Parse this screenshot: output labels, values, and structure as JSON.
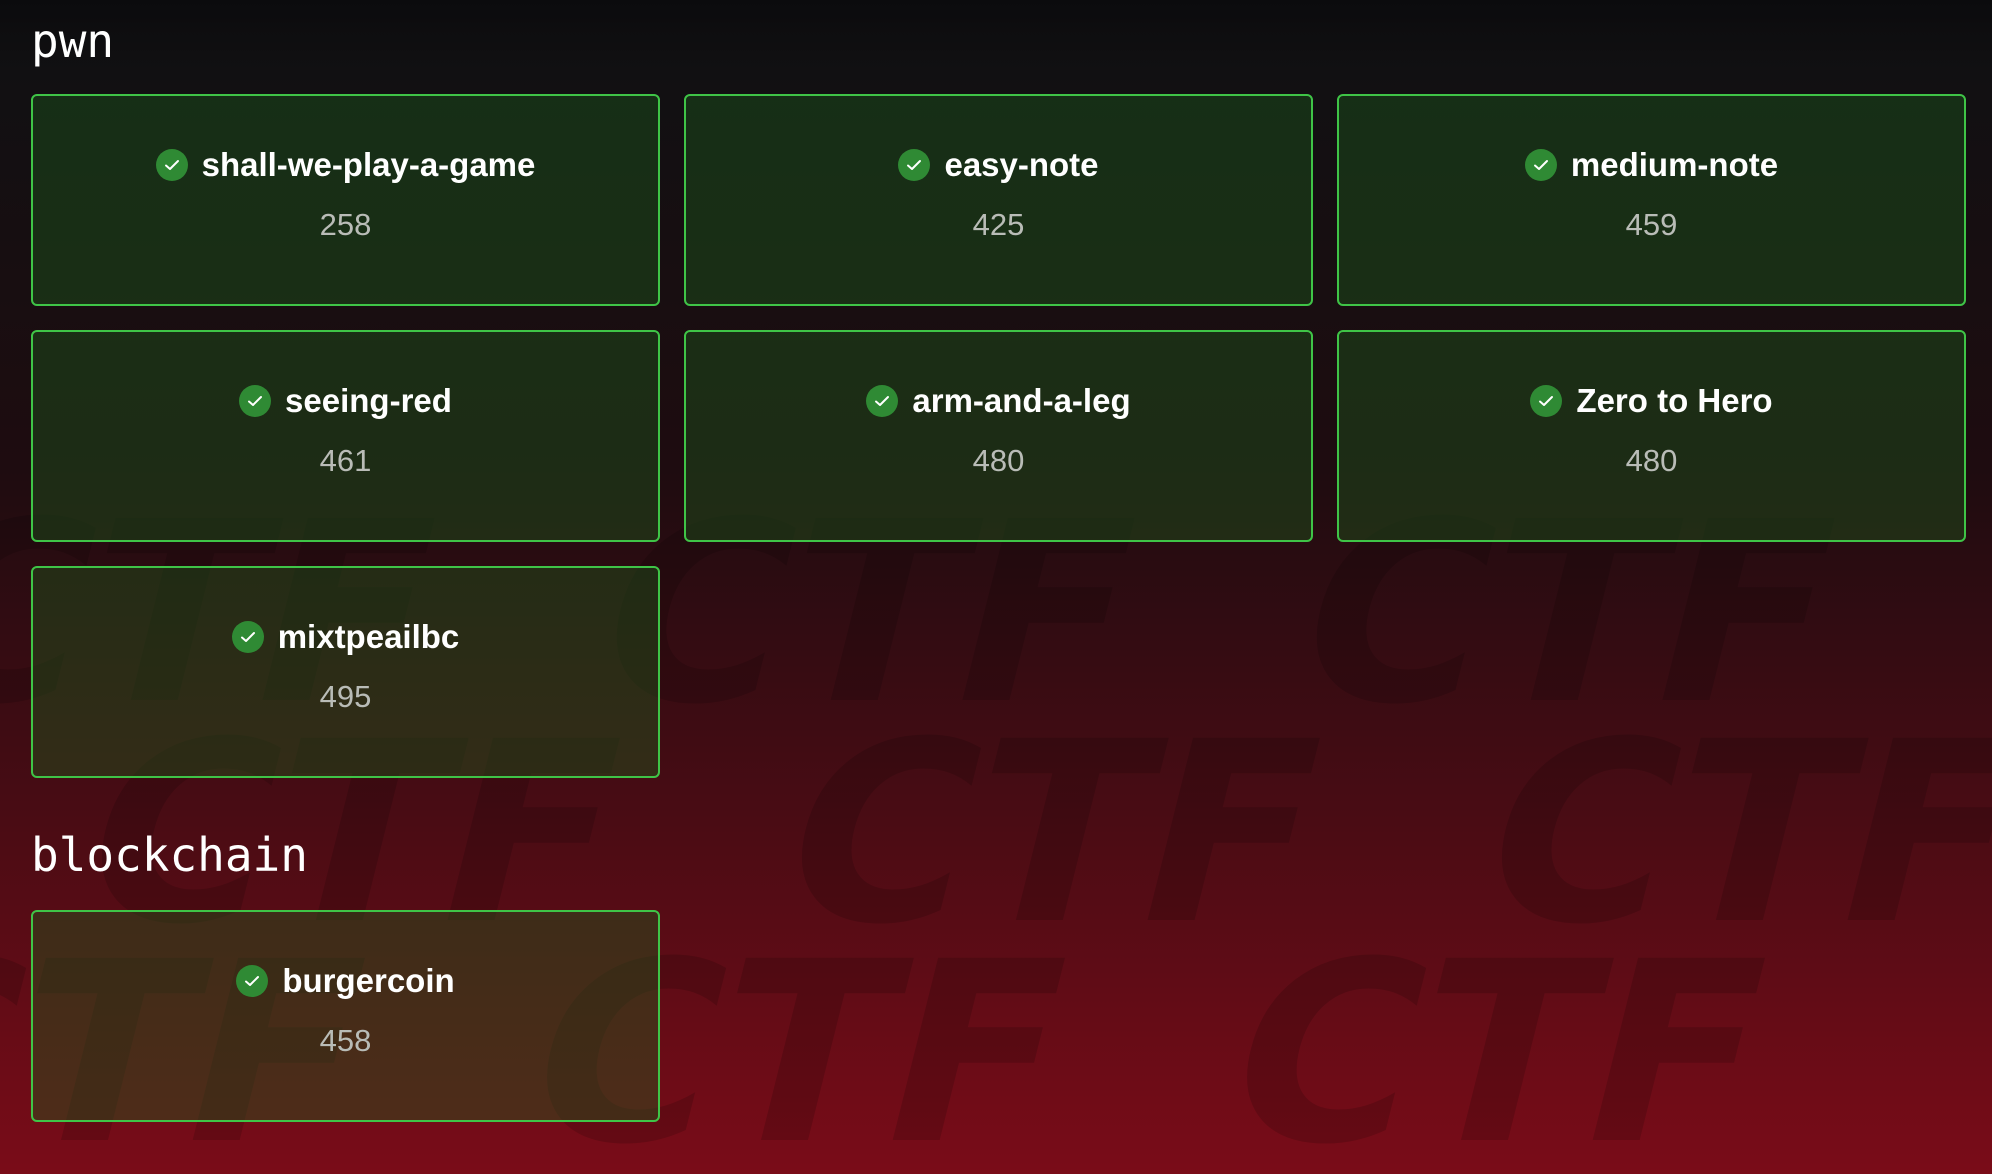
{
  "sections": [
    {
      "title": "pwn",
      "challenges": [
        {
          "name": "shall-we-play-a-game",
          "points": "258",
          "solved_icon": "check-circle-icon"
        },
        {
          "name": "easy-note",
          "points": "425",
          "solved_icon": "check-circle-icon"
        },
        {
          "name": "medium-note",
          "points": "459",
          "solved_icon": "check-circle-icon"
        },
        {
          "name": "seeing-red",
          "points": "461",
          "solved_icon": "check-circle-icon"
        },
        {
          "name": "arm-and-a-leg",
          "points": "480",
          "solved_icon": "check-circle-icon"
        },
        {
          "name": "Zero to Hero",
          "points": "480",
          "solved_icon": "check-circle-icon"
        },
        {
          "name": "mixtpeailbc",
          "points": "495",
          "solved_icon": "check-circle-icon"
        }
      ]
    },
    {
      "title": "blockchain",
      "challenges": [
        {
          "name": "burgercoin",
          "points": "458",
          "solved_icon": "check-circle-icon"
        }
      ]
    }
  ],
  "colors": {
    "card_border": "#3fc447",
    "check_bg": "#2f8a34",
    "points_text": "#b9bcb7"
  }
}
